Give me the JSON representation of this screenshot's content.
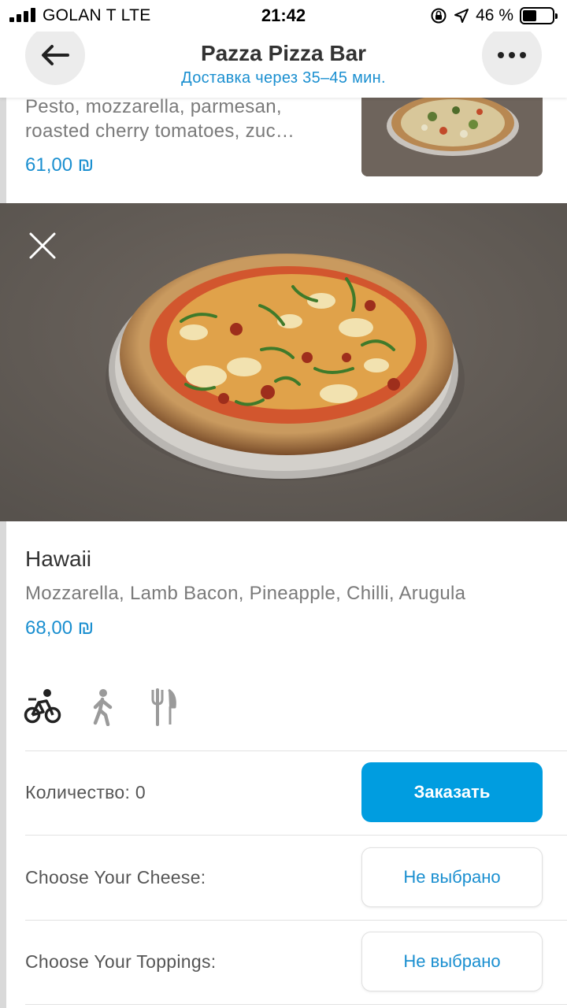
{
  "status_bar": {
    "carrier": "GOLAN T   LTE",
    "time": "21:42",
    "battery_percent": "46 %",
    "battery_level": 0.46
  },
  "header": {
    "title": "Pazza Pizza Bar",
    "subtitle": "Доставка через 35–45 мин.",
    "back_icon": "arrow-left-icon",
    "more_icon": "more-dots-icon"
  },
  "previous_item": {
    "description": "Pesto, mozzarella, parmesan, roasted cherry tomatoes, zuc…",
    "price": "61,00 ₪"
  },
  "item": {
    "name": "Hawaii",
    "description": "Mozzarella, Lamb Bacon, Pineapple, Chilli, Arugula",
    "price": "68,00 ₪",
    "close_icon": "close-icon"
  },
  "order_modes": [
    {
      "icon": "bicycle-delivery-icon",
      "selected": true
    },
    {
      "icon": "walking-pickup-icon",
      "selected": false
    },
    {
      "icon": "fork-knife-icon",
      "selected": false
    }
  ],
  "quantity": {
    "label": "Количество: 0",
    "order_button": "Заказать"
  },
  "options": [
    {
      "label": "Choose Your Cheese:",
      "value": "Не выбрано"
    },
    {
      "label": "Choose Your Toppings:",
      "value": "Не выбрано"
    }
  ],
  "colors": {
    "accent": "#009de0",
    "link_blue": "#1a8fd0",
    "muted_text": "#7a7a7a"
  }
}
